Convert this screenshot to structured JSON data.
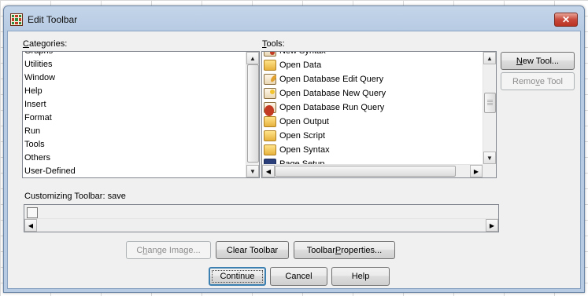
{
  "dialog": {
    "title": "Edit Toolbar",
    "close_glyph": "✕"
  },
  "categories": {
    "label_accel": "C",
    "label_rest": "ategories:",
    "items": [
      "Graphs",
      "Utilities",
      "Window",
      "Help",
      "Insert",
      "Format",
      "Run",
      "Tools",
      "Others",
      "User-Defined"
    ]
  },
  "tools": {
    "label_accel": "T",
    "label_rest": "ools:",
    "items": [
      {
        "label": "New Syntax",
        "icon": "syntax-icon"
      },
      {
        "label": "Open Data",
        "icon": "open-data-icon"
      },
      {
        "label": "Open Database Edit Query",
        "icon": "db-edit-query-icon"
      },
      {
        "label": "Open Database New Query",
        "icon": "db-new-query-icon"
      },
      {
        "label": "Open Database Run Query",
        "icon": "db-run-query-icon"
      },
      {
        "label": "Open Output",
        "icon": "open-output-icon"
      },
      {
        "label": "Open Script",
        "icon": "open-script-icon"
      },
      {
        "label": "Open Syntax",
        "icon": "open-syntax-icon"
      },
      {
        "label": "Page Setup",
        "icon": "page-setup-icon"
      }
    ]
  },
  "buttons": {
    "new_tool_accel": "N",
    "new_tool_rest": "ew Tool...",
    "remove_tool_pre": "Remo",
    "remove_tool_accel": "v",
    "remove_tool_post": "e Tool",
    "change_image_pre": "C",
    "change_image_accel": "h",
    "change_image_post": "ange Image...",
    "clear_toolbar": "Clear Toolbar",
    "toolbar_properties_pre": "Toolbar ",
    "toolbar_properties_accel": "P",
    "toolbar_properties_post": "roperties...",
    "continue": "Continue",
    "cancel": "Cancel",
    "help": "Help"
  },
  "customizing": {
    "label": "Customizing Toolbar:",
    "toolbar_name": "save"
  },
  "scroll_glyphs": {
    "up": "▲",
    "down": "▼",
    "left": "◀",
    "right": "▶"
  }
}
